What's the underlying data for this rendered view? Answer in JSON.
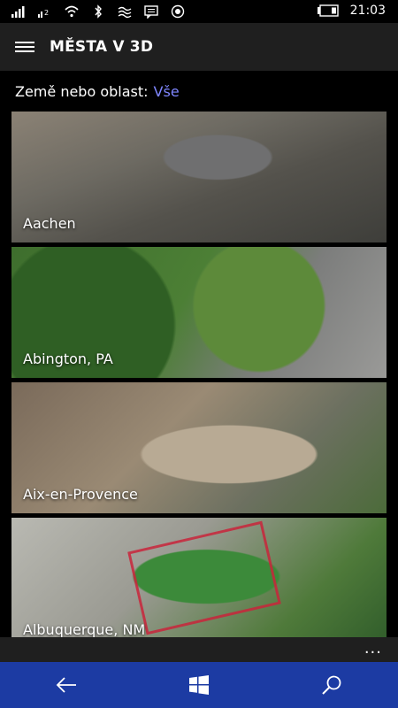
{
  "status_bar": {
    "time": "21:03",
    "icons": [
      "signal-icon",
      "signal-2-icon",
      "wifi-icon",
      "bluetooth-icon",
      "network-icon",
      "message-icon",
      "record-icon",
      "battery-icon"
    ]
  },
  "app_bar": {
    "title": "MĚSTA V 3D",
    "menu_icon": "hamburger-icon"
  },
  "filter": {
    "label": "Země nebo oblast:",
    "value": "Vše"
  },
  "cities": [
    {
      "name": "Aachen"
    },
    {
      "name": "Abington, PA"
    },
    {
      "name": "Aix-en-Provence"
    },
    {
      "name": "Albuquerque, NM"
    }
  ],
  "app_bar_more": "...",
  "nav": {
    "icons": [
      "back-arrow-icon",
      "windows-start-icon",
      "search-icon"
    ]
  }
}
